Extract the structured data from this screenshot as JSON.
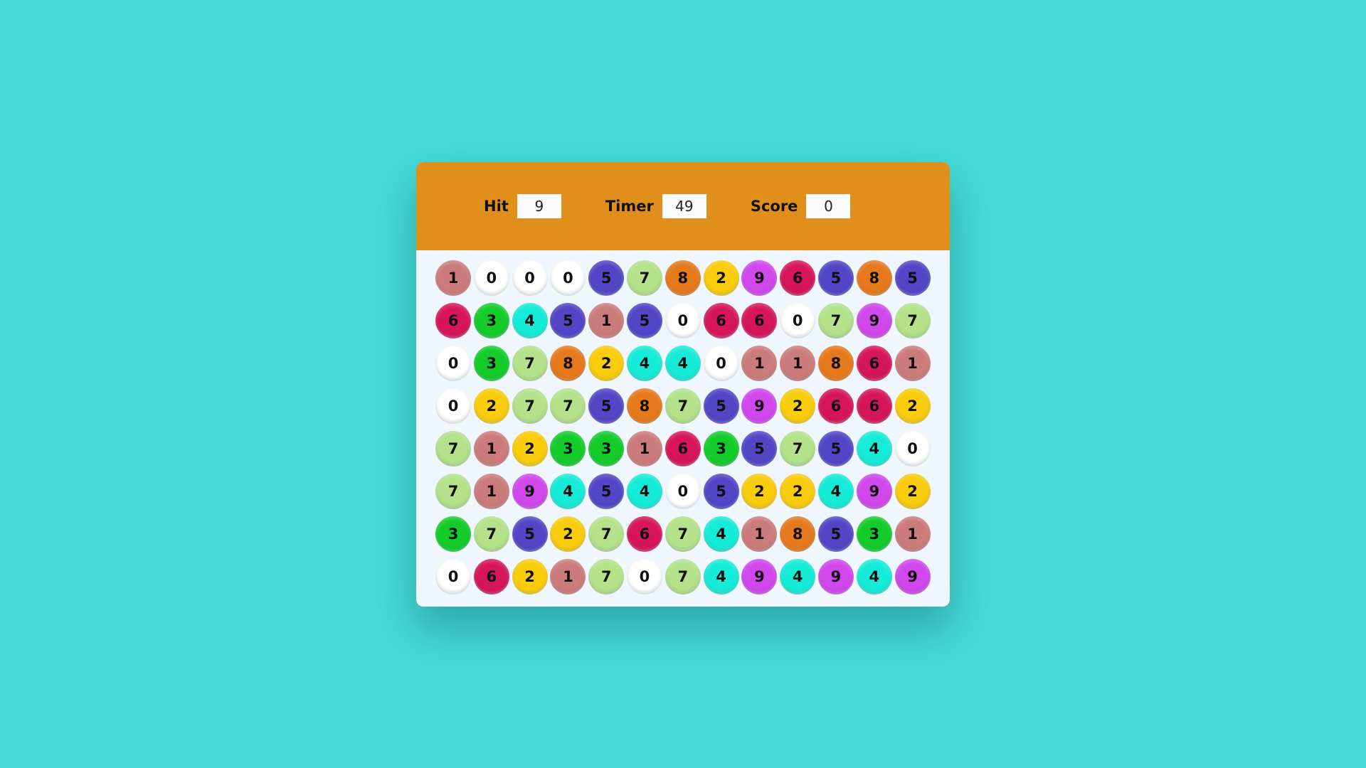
{
  "panel_top": {
    "hit_label": "Hit",
    "hit_value": "9",
    "timer_label": "Timer",
    "timer_value": "49",
    "score_label": "Score",
    "score_value": "0"
  },
  "colors": {
    "background": "#45d9d9",
    "top_bar": "#e08f1a",
    "panel": "#eff6fd",
    "digit_colors": {
      "0": "#ffffff",
      "1": "#cc7b7b",
      "2": "#f9cc0c",
      "3": "#13cc2a",
      "4": "#15ecd8",
      "5": "#5444c6",
      "6": "#d6155a",
      "7": "#b3e28a",
      "8": "#e6791c",
      "9": "#d047ec"
    }
  },
  "grid": [
    [
      "1",
      "0",
      "0",
      "0",
      "5",
      "7",
      "8",
      "2",
      "9",
      "6",
      "5",
      "8",
      "5"
    ],
    [
      "6",
      "3",
      "4",
      "5",
      "1",
      "5",
      "0",
      "6",
      "6",
      "0",
      "7",
      "9",
      "7"
    ],
    [
      "0",
      "3",
      "7",
      "8",
      "2",
      "4",
      "4",
      "0",
      "1",
      "1",
      "8",
      "6",
      "1"
    ],
    [
      "0",
      "2",
      "7",
      "7",
      "5",
      "8",
      "7",
      "5",
      "9",
      "2",
      "6",
      "6",
      "2"
    ],
    [
      "7",
      "1",
      "2",
      "3",
      "3",
      "1",
      "6",
      "3",
      "5",
      "7",
      "5",
      "4",
      "0"
    ],
    [
      "7",
      "1",
      "9",
      "4",
      "5",
      "4",
      "0",
      "5",
      "2",
      "2",
      "4",
      "9",
      "2"
    ],
    [
      "3",
      "7",
      "5",
      "2",
      "7",
      "6",
      "7",
      "4",
      "1",
      "8",
      "5",
      "3",
      "1"
    ],
    [
      "0",
      "6",
      "2",
      "1",
      "7",
      "0",
      "7",
      "4",
      "9",
      "4",
      "9",
      "4",
      "9"
    ]
  ]
}
